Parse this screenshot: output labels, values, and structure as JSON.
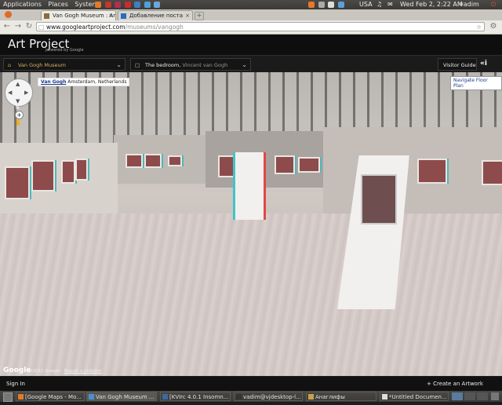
{
  "system_panel": {
    "menus": [
      "Applications",
      "Places",
      "System"
    ],
    "keyboard_layout": "USA",
    "datetime": "Wed Feb 2, 2:22 AM",
    "user": "vadim"
  },
  "browser": {
    "tabs": [
      {
        "label": "Van Gogh Museum : Art...",
        "active": true
      },
      {
        "label": "Добавление поста",
        "active": false
      }
    ],
    "url_host": "www.googleartproject.com",
    "url_path": "/museums/vangogh"
  },
  "art_project": {
    "title": "Art Project",
    "powered_by": "powered by Google",
    "museum_select": "Van Gogh Museum",
    "artwork_select_prefix": "The bedroom,",
    "artwork_select_artist": "Vincent van Gogh",
    "visitor_guide": "Visitor Guide",
    "info_icon_label": "i"
  },
  "viewer": {
    "location_name": "Van Gogh",
    "location_detail": "Amsterdam, Netherlands",
    "floor_plan_label": "Navigate Floor Plan",
    "compass_n": "N",
    "google_logo": "Google",
    "copyright": "©2011 Google",
    "report_problem": "Report a problem"
  },
  "footer": {
    "sign_in": "Sign In",
    "create_collection": "Create an Artwork Collection"
  },
  "taskbar": {
    "items": [
      "[Google Maps - Mo...",
      "Van Gogh Museum ...",
      "[KVIrc 4.0.1 Insomn...",
      "vadim@vjdesktop-l...",
      "Анаглифы",
      "*Untitled Documen..."
    ]
  },
  "colors": {
    "panel": "#3b3a36",
    "header": "#0e0e0e",
    "accent_gold": "#d9b15f",
    "link_blue": "#1a3a8a"
  }
}
